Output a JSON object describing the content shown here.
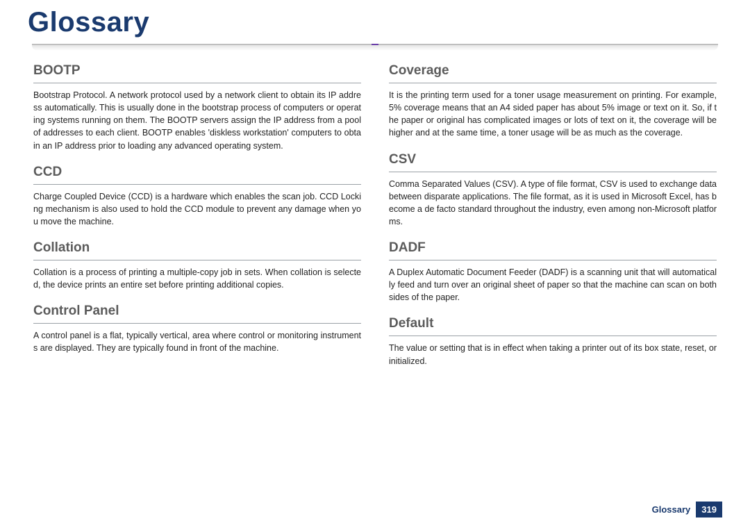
{
  "title": "Glossary",
  "footer": {
    "label": "Glossary",
    "page": "319"
  },
  "left": [
    {
      "term": "BOOTP",
      "def": "Bootstrap Protocol. A network protocol used by a network client to obtain its IP address automatically. This is usually done in the bootstrap process of computers or operating systems running on them. The BOOTP servers assign the IP address from a pool of addresses to each client. BOOTP enables 'diskless workstation' computers to obtain an IP address prior to loading any advanced operating system."
    },
    {
      "term": "CCD",
      "def": "Charge Coupled Device (CCD) is a hardware which enables the scan job. CCD Locking mechanism is also used to hold the CCD module to prevent any damage when you move the machine."
    },
    {
      "term": "Collation",
      "def": "Collation is a process of printing a multiple-copy job in sets. When collation is selected, the device prints an entire set before printing additional copies."
    },
    {
      "term": "Control Panel",
      "def": "A control panel is a flat, typically vertical, area where control or monitoring instruments are displayed. They are typically found in front of the machine."
    }
  ],
  "right": [
    {
      "term": "Coverage",
      "def": "It is the printing term used for a toner usage measurement on printing. For example, 5% coverage means that an A4 sided paper has about 5% image or text on it. So, if the paper or original has complicated images or lots of text on it, the coverage will be higher and at the same time, a toner usage will be as much as the coverage."
    },
    {
      "term": "CSV",
      "def": "Comma Separated Values (CSV). A type of file format, CSV is used to exchange data between disparate applications. The file format, as it is used in Microsoft Excel, has become a de facto standard throughout the industry, even among non-Microsoft platforms."
    },
    {
      "term": "DADF",
      "def": "A Duplex Automatic Document Feeder (DADF) is a scanning unit that will automatically feed and turn over an original sheet of paper so that the machine can scan on both sides of the paper."
    },
    {
      "term": "Default",
      "def": "The value or setting that is in effect when taking a printer out of its box state, reset, or initialized."
    }
  ]
}
